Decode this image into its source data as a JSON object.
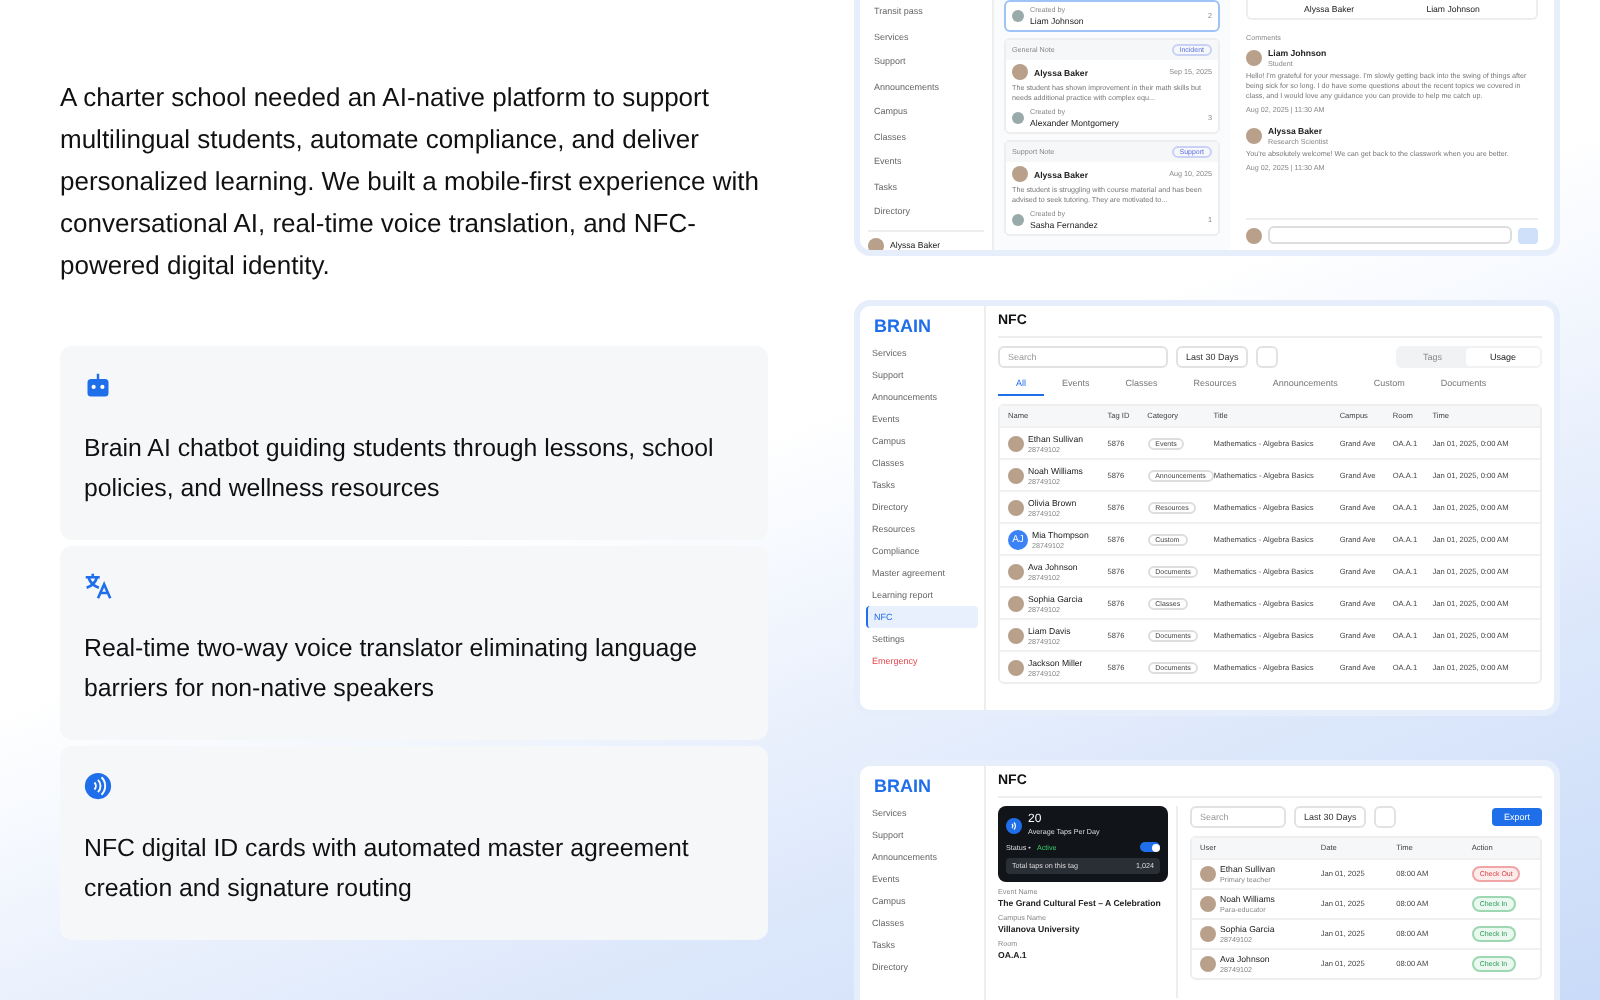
{
  "intro": "A charter school needed an AI-native platform to support multilingual students, automate compliance, and deliver personalized learning. We built a mobile-first experience with conversational AI, real-time voice translation, and NFC-powered digital identity.",
  "features": [
    {
      "kind": "chatbot",
      "text": "Brain AI chatbot guiding students through lessons, school policies, and wellness resources"
    },
    {
      "kind": "translate",
      "text": "Real-time two-way voice translator eliminating language barriers for non-native speakers"
    },
    {
      "kind": "nfc",
      "text": "NFC digital ID cards with automated master agreement creation and signature routing"
    }
  ],
  "notes_screen": {
    "sidebar": [
      "Transit pass",
      "Services",
      "Support",
      "Announcements",
      "Campus",
      "Classes",
      "Events",
      "Tasks",
      "Directory"
    ],
    "user": "Alyssa Baker",
    "first_note": {
      "creator_label": "Created by",
      "creator": "Liam Johnson",
      "count": "2"
    },
    "notes": [
      {
        "type": "General Note",
        "tag": "Incident",
        "author": "Alyssa Baker",
        "date": "Sep 15, 2025",
        "text": "The student has shown improvement in their math skills but needs additional practice with complex equ...",
        "creator_label": "Created by",
        "creator": "Alexander Montgomery",
        "count": "3"
      },
      {
        "type": "Support Note",
        "tag": "Support",
        "author": "Alyssa Baker",
        "date": "Aug 10, 2025",
        "text": "The student is struggling with course material and has been advised to seek tutoring. They are motivated to...",
        "creator_label": "Created by",
        "creator": "Sasha Fernandez",
        "count": "1"
      }
    ],
    "people": [
      "Alyssa Baker",
      "Liam Johnson"
    ],
    "comments_title": "Comments",
    "comments": [
      {
        "name": "Liam Johnson",
        "role": "Student",
        "text": "Hello! I'm grateful for your message. I'm slowly getting back into the swing of things after being sick for so long. I do have some questions about the recent topics we covered in class, and I would love any guidance you can provide to help me catch up.",
        "time": "Aug 02, 2025 | 11:30 AM"
      },
      {
        "name": "Alyssa Baker",
        "role": "Research Scientist",
        "text": "You're absolutely welcome! We can get back to the classwork when you are better.",
        "time": "Aug 02, 2025 | 11:30 AM"
      }
    ]
  },
  "tags_screen": {
    "logo": "BRAIN",
    "title": "NFC",
    "sidebar": [
      {
        "label": "Services",
        "selected": false,
        "kind": "normal"
      },
      {
        "label": "Support",
        "selected": false,
        "kind": "normal"
      },
      {
        "label": "Announcements",
        "selected": false,
        "kind": "normal"
      },
      {
        "label": "Events",
        "selected": false,
        "kind": "normal"
      },
      {
        "label": "Campus",
        "selected": false,
        "kind": "normal"
      },
      {
        "label": "Classes",
        "selected": false,
        "kind": "normal"
      },
      {
        "label": "Tasks",
        "selected": false,
        "kind": "normal"
      },
      {
        "label": "Directory",
        "selected": false,
        "kind": "normal"
      },
      {
        "label": "Resources",
        "selected": false,
        "kind": "normal"
      },
      {
        "label": "Compliance",
        "selected": false,
        "kind": "normal"
      },
      {
        "label": "Master agreement",
        "selected": false,
        "kind": "normal"
      },
      {
        "label": "Learning report",
        "selected": false,
        "kind": "normal"
      },
      {
        "label": "NFC",
        "selected": true,
        "kind": "normal"
      },
      {
        "label": "Settings",
        "selected": false,
        "kind": "normal"
      },
      {
        "label": "Emergency",
        "selected": false,
        "kind": "danger"
      }
    ],
    "search": {
      "placeholder": "Search"
    },
    "range": "Last 30 Days",
    "views": [
      {
        "label": "Tags",
        "selected": false
      },
      {
        "label": "Usage",
        "selected": true
      }
    ],
    "tabs": [
      {
        "label": "All",
        "selected": true
      },
      {
        "label": "Events",
        "selected": false
      },
      {
        "label": "Classes",
        "selected": false
      },
      {
        "label": "Resources",
        "selected": false
      },
      {
        "label": "Announcements",
        "selected": false
      },
      {
        "label": "Custom",
        "selected": false
      },
      {
        "label": "Documents",
        "selected": false
      }
    ],
    "columns": [
      "Name",
      "Tag ID",
      "Category",
      "Title",
      "Campus",
      "Room",
      "Time"
    ],
    "rows": [
      {
        "name": "Ethan Sullivan",
        "id": "28749102",
        "tag": "5876",
        "category": "Events",
        "title": "Mathematics - Algebra Basics",
        "campus": "Grand Ave",
        "room": "OA.A.1",
        "time": "Jan 01, 2025, 0:00 AM"
      },
      {
        "name": "Noah Williams",
        "id": "28749102",
        "tag": "5876",
        "category": "Announcements",
        "title": "Mathematics - Algebra Basics",
        "campus": "Grand Ave",
        "room": "OA.A.1",
        "time": "Jan 01, 2025, 0:00 AM"
      },
      {
        "name": "Olivia Brown",
        "id": "28749102",
        "tag": "5876",
        "category": "Resources",
        "title": "Mathematics - Algebra Basics",
        "campus": "Grand Ave",
        "room": "OA.A.1",
        "time": "Jan 01, 2025, 0:00 AM"
      },
      {
        "name": "Mia Thompson",
        "initials": "AJ",
        "id": "28749102",
        "tag": "5876",
        "category": "Custom",
        "title": "Mathematics - Algebra Basics",
        "campus": "Grand Ave",
        "room": "OA.A.1",
        "time": "Jan 01, 2025, 0:00 AM"
      },
      {
        "name": "Ava Johnson",
        "id": "28749102",
        "tag": "5876",
        "category": "Documents",
        "title": "Mathematics - Algebra Basics",
        "campus": "Grand Ave",
        "room": "OA.A.1",
        "time": "Jan 01, 2025, 0:00 AM"
      },
      {
        "name": "Sophia Garcia",
        "id": "28749102",
        "tag": "5876",
        "category": "Classes",
        "title": "Mathematics - Algebra Basics",
        "campus": "Grand Ave",
        "room": "OA.A.1",
        "time": "Jan 01, 2025, 0:00 AM"
      },
      {
        "name": "Liam Davis",
        "id": "28749102",
        "tag": "5876",
        "category": "Documents",
        "title": "Mathematics - Algebra Basics",
        "campus": "Grand Ave",
        "room": "OA.A.1",
        "time": "Jan 01, 2025, 0:00 AM"
      },
      {
        "name": "Jackson Miller",
        "id": "28749102",
        "tag": "5876",
        "category": "Documents",
        "title": "Mathematics - Algebra Basics",
        "campus": "Grand Ave",
        "room": "OA.A.1",
        "time": "Jan 01, 2025, 0:00 AM"
      }
    ]
  },
  "usage_screen": {
    "logo": "BRAIN",
    "title": "NFC",
    "sidebar": [
      "Services",
      "Support",
      "Announcements",
      "Events",
      "Campus",
      "Classes",
      "Tasks",
      "Directory"
    ],
    "card": {
      "value": "20",
      "caption": "Average Taps Per Day",
      "status_label": "Status •",
      "status": "Active",
      "on": true,
      "total_label": "Total taps on this tag",
      "total": "1,024"
    },
    "fields": [
      {
        "label": "Event Name",
        "value": "The Grand Cultural Fest – A Celebration"
      },
      {
        "label": "Campus Name",
        "value": "Villanova University"
      },
      {
        "label": "Room",
        "value": "OA.A.1"
      }
    ],
    "search": {
      "placeholder": "Search"
    },
    "range": "Last 30 Days",
    "export": "Export",
    "columns": [
      "User",
      "Date",
      "Time",
      "Action"
    ],
    "rows": [
      {
        "name": "Ethan Sullivan",
        "sub": "Primary teacher",
        "date": "Jan 01, 2025",
        "time": "08:00 AM",
        "action": "Check Out",
        "kind": "out"
      },
      {
        "name": "Noah Williams",
        "sub": "Para-educator",
        "date": "Jan 01, 2025",
        "time": "08:00 AM",
        "action": "Check In",
        "kind": "in"
      },
      {
        "name": "Sophia Garcia",
        "sub": "28749102",
        "date": "Jan 01, 2025",
        "time": "08:00 AM",
        "action": "Check In",
        "kind": "in"
      },
      {
        "name": "Ava Johnson",
        "sub": "28749102",
        "date": "Jan 01, 2025",
        "time": "08:00 AM",
        "action": "Check In",
        "kind": "in"
      }
    ]
  }
}
